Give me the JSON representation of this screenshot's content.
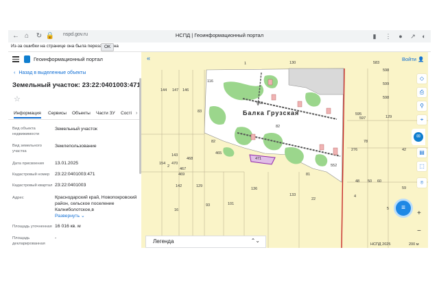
{
  "browser": {
    "url": "nspd.gov.ru",
    "tab_title": "НСПД | Геоинформационный портал",
    "warning_text": "Из-за ошибки на странице она была перезагружена",
    "warning_ok": "OK"
  },
  "header": {
    "portal_name": "Геоинформационный портал"
  },
  "panel": {
    "back_label": "Назад в выделенные объекты",
    "title": "Земельный участок: 23:22:0401003:471",
    "tabs": [
      {
        "label": "Информация",
        "active": true
      },
      {
        "label": "Сервисы"
      },
      {
        "label": "Объекты"
      },
      {
        "label": "Части ЗУ"
      },
      {
        "label": "Сості"
      }
    ],
    "rows": [
      {
        "label": "Вид объекта недвижимости",
        "value": "Земельный участок"
      },
      {
        "label": "Вид земельного участка",
        "value": "Землепользование"
      },
      {
        "label": "Дата присвоения",
        "value": "13.01.2025"
      },
      {
        "label": "Кадастровый номер",
        "value": "23:22:0401003:471"
      },
      {
        "label": "Кадастровый квартал",
        "value": "23:22:0401003"
      },
      {
        "label": "Адрес",
        "value": "Краснодарский край, Новопокровский район, сельское поселение Калниболотское,в",
        "expand": "Развернуть"
      },
      {
        "label": "Площадь уточненная",
        "value": "16 016 кв. м"
      },
      {
        "label": "Площадь декларированная",
        "value": "-"
      }
    ]
  },
  "map": {
    "login": "Войти",
    "village": "Балка Грузская",
    "legend": "Легенда",
    "attribution": "НСПД 2025",
    "scale": "200 м",
    "parcel_numbers": [
      {
        "t": "130"
      },
      {
        "t": "1"
      },
      {
        "t": "144"
      },
      {
        "t": "147"
      },
      {
        "t": "146"
      },
      {
        "t": "116"
      },
      {
        "t": "83"
      },
      {
        "t": "82"
      },
      {
        "t": "82"
      },
      {
        "t": "550"
      },
      {
        "t": "143"
      },
      {
        "t": "470"
      },
      {
        "t": "468"
      },
      {
        "t": "465"
      },
      {
        "t": "471"
      },
      {
        "t": "154"
      },
      {
        "t": "2"
      },
      {
        "t": "467"
      },
      {
        "t": "469"
      },
      {
        "t": "142"
      },
      {
        "t": "129"
      },
      {
        "t": "136"
      },
      {
        "t": "133"
      },
      {
        "t": "22"
      },
      {
        "t": "93"
      },
      {
        "t": "101"
      },
      {
        "t": "16"
      },
      {
        "t": "81"
      },
      {
        "t": "276"
      },
      {
        "t": "552"
      },
      {
        "t": "78"
      },
      {
        "t": "48"
      },
      {
        "t": "50"
      },
      {
        "t": "60"
      },
      {
        "t": "4"
      },
      {
        "t": "59"
      },
      {
        "t": "5"
      },
      {
        "t": "583"
      },
      {
        "t": "598"
      },
      {
        "t": "599"
      },
      {
        "t": "595"
      },
      {
        "t": "597"
      },
      {
        "t": "129"
      },
      {
        "t": "598"
      },
      {
        "t": "42"
      }
    ]
  }
}
